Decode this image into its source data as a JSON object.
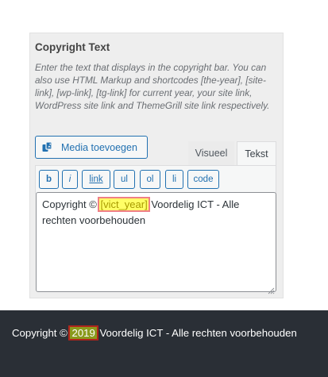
{
  "panel": {
    "title": "Copyright Text",
    "description": "Enter the text that displays in the copyright bar. You can also use HTML Markup and shortcodes [the-year], [site-link], [wp-link], [tg-link] for current year, your site link, WordPress site link and ThemeGrill site link respectively."
  },
  "media_button": {
    "label": "Media toevoegen",
    "icon": "media-icon"
  },
  "tabs": {
    "visual": "Visueel",
    "text": "Tekst",
    "active": "text"
  },
  "quicktags": [
    "b",
    "i",
    "link",
    "ul",
    "ol",
    "li",
    "code"
  ],
  "editor": {
    "prefix": "Copyright © ",
    "shortcode": "[vict_year]",
    "suffix": " Voordelig ICT - Alle rechten voorbehouden"
  },
  "footer": {
    "prefix": "Copyright © ",
    "year": "2019",
    "suffix": " Voordelig ICT - Alle rechten voorbehouden"
  },
  "colors": {
    "footer_bg": "#2a2f36",
    "accent": "#2271b1",
    "shortcode_highlight": "#ffff66",
    "year_highlight": "#8a9a1c",
    "highlight_border": "#b0251c"
  }
}
